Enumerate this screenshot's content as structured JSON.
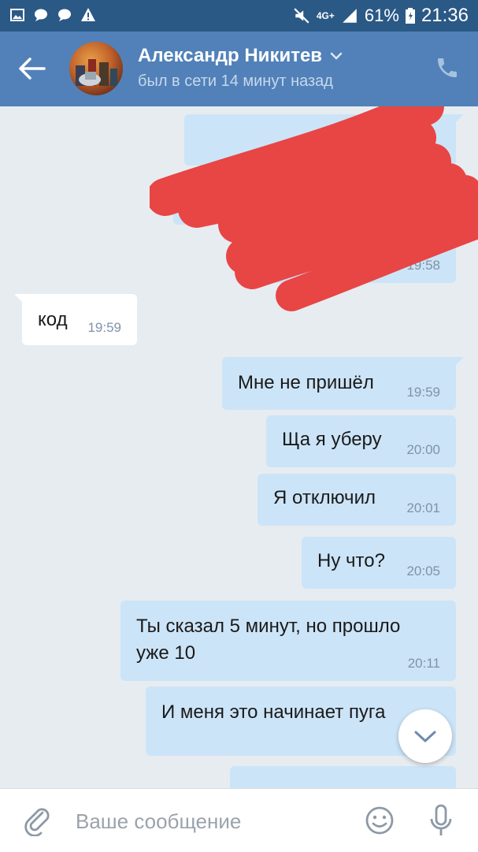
{
  "status_bar": {
    "network": "4G+",
    "battery": "61%",
    "time": "21:36",
    "left_icons": [
      "image-icon",
      "chat-icon",
      "chat-icon",
      "warning-icon"
    ],
    "right_icons": [
      "mute-icon",
      "signal-icon",
      "battery-icon"
    ]
  },
  "header": {
    "name": "Александр Никитев",
    "status": "был в сети 14 минут назад",
    "icons": [
      "back-arrow-icon",
      "chevron-down-icon",
      "phone-icon"
    ]
  },
  "messages": [
    {
      "direction": "in",
      "text": "код",
      "time": "19:59"
    },
    {
      "direction": "out",
      "text": "Мне не пришёл",
      "time": "19:59"
    },
    {
      "direction": "out",
      "text": "Ща я уберу",
      "time": "20:00"
    },
    {
      "direction": "out",
      "text": "Я отключил",
      "time": "20:01"
    },
    {
      "direction": "out",
      "text": "Ну что?",
      "time": "20:05"
    },
    {
      "direction": "out",
      "text_line1": "Ты сказал 5 минут, но прошло",
      "text_line2": "уже 10",
      "time": "20:11"
    },
    {
      "direction": "out",
      "text": "И меня это начинает пуга",
      "time": ""
    }
  ],
  "redacted_times": [
    "19:58",
    "19:58"
  ],
  "input": {
    "placeholder": "Ваше сообщение",
    "icons": [
      "paperclip-icon",
      "smile-icon",
      "microphone-icon"
    ]
  },
  "colors": {
    "header": "#5181b8",
    "status_bar": "#2b5986",
    "outgoing_bubble": "#cce4f7",
    "incoming_bubble": "#ffffff",
    "background": "#e7ecf0",
    "redaction": "#e84545"
  }
}
